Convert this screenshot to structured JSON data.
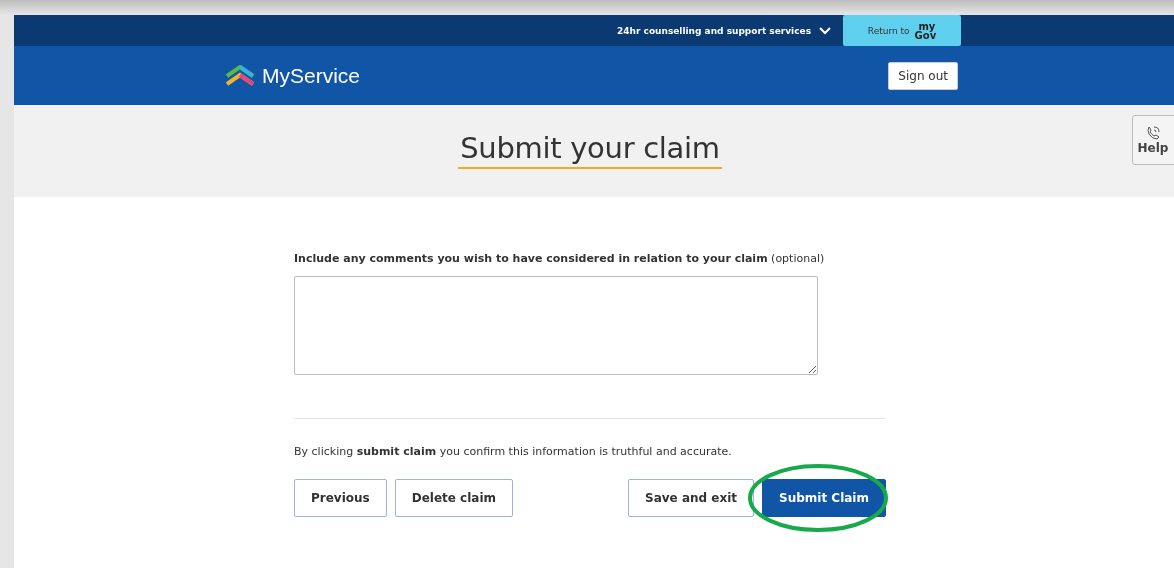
{
  "top_bar": {
    "support_menu": {
      "label": "24hr counselling and support services",
      "expanded": false
    },
    "return_button": {
      "label": "Return to",
      "logo_top": "my",
      "logo_bottom": "Gov"
    }
  },
  "header": {
    "brand": "MyService",
    "sign_out": "Sign out"
  },
  "help_tab": {
    "label": "Help"
  },
  "page_title": "Submit your claim",
  "comments": {
    "label": "**Include any comments you wish to have considered in relation to your claim** (optional)"
  },
  "declaration": "By clicking **submit claim** you confirm this information is truthful and accurate.",
  "left_buttons": [
    {
      "label": "Previous",
      "kind": "secondary"
    },
    {
      "label": "Delete claim",
      "kind": "secondary"
    }
  ],
  "right_buttons": [
    {
      "label": "Save and exit",
      "kind": "secondary"
    },
    {
      "label": "Submit Claim",
      "kind": "primary",
      "annotated": true
    }
  ]
}
